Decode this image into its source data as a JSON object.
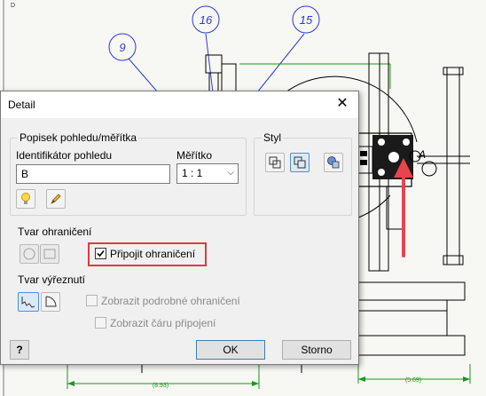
{
  "drawing": {
    "balloons": [
      "9",
      "16",
      "15"
    ],
    "detail_label": "A",
    "dim_left": "(8.93)",
    "dim_right": "(5.69)",
    "corner_mark": "D"
  },
  "dialog": {
    "title": "Detail",
    "close_glyph": "✕",
    "view_group": {
      "title": "Popisek pohledu/měřítka",
      "identifier_label": "Identifikátor pohledu",
      "identifier_value": "B",
      "scale_label": "Měřítko",
      "scale_value": "1 : 1"
    },
    "style_group": {
      "title": "Styl"
    },
    "boundary_shape_label": "Tvar ohraničení",
    "attach_boundary": {
      "label": "Připojit ohraničení",
      "checked": true
    },
    "cutout_shape_label": "Tvar výřeznutí",
    "show_full_boundary": {
      "label": "Zobrazit podrobné ohraničení",
      "checked": false
    },
    "show_connection_line": {
      "label": "Zobrazit čáru připojení",
      "checked": false
    },
    "ok_label": "OK",
    "cancel_label": "Storno",
    "help_glyph": "?"
  },
  "colors": {
    "balloon": "#2a3bd6",
    "dimension": "#1a9a1a",
    "highlight": "#e03b3b",
    "arrow": "#e8434e"
  }
}
